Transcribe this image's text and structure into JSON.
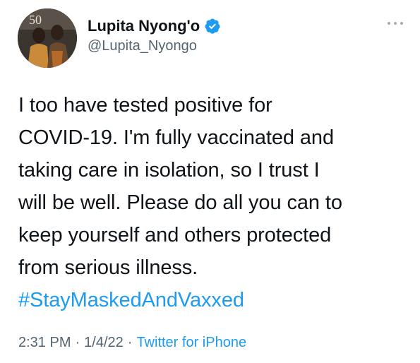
{
  "author": {
    "display_name": "Lupita Nyong'o",
    "handle": "@Lupita_Nyongo",
    "verified": true,
    "avatar_badge": "50"
  },
  "tweet": {
    "lines": [
      "I too have tested positive for",
      "COVID-19. I'm fully vaccinated and",
      "taking care in isolation, so I trust I",
      "will be well. Please do all you can to",
      "keep yourself and others protected",
      "from serious illness."
    ],
    "hashtag": "#StayMaskedAndVaxxed"
  },
  "meta": {
    "time": "2:31 PM",
    "separator": "·",
    "date": "1/4/22",
    "source": "Twitter for iPhone"
  },
  "colors": {
    "accent": "#1d9bf0",
    "text": "#0f1419",
    "secondary": "#536471"
  },
  "icons": {
    "verified": "verified-badge-icon",
    "more": "more-options-icon"
  }
}
